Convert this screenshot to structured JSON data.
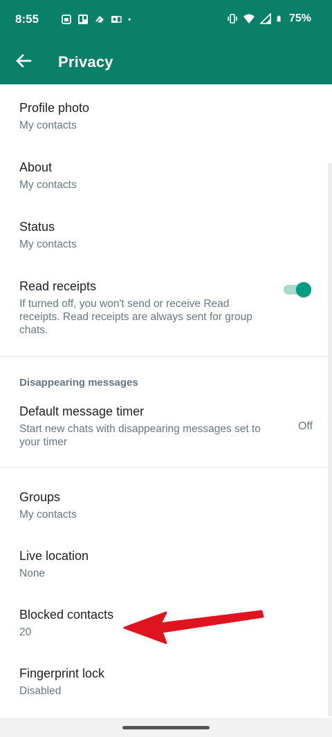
{
  "status_bar": {
    "time": "8:55",
    "battery": "75%",
    "icons": [
      "calendar-icon",
      "trello-icon",
      "cloud-icon",
      "outlook-icon",
      "dot-icon",
      "vibrate-icon",
      "wifi-icon",
      "signal-icon",
      "battery-icon"
    ]
  },
  "app_bar": {
    "title": "Privacy",
    "back_icon": "arrow-left-icon"
  },
  "items": {
    "profile_photo": {
      "title": "Profile photo",
      "subtitle": "My contacts"
    },
    "about": {
      "title": "About",
      "subtitle": "My contacts"
    },
    "status": {
      "title": "Status",
      "subtitle": "My contacts"
    },
    "read_receipts": {
      "title": "Read receipts",
      "subtitle": "If turned off, you won't send or receive Read receipts. Read receipts are always sent for group chats.",
      "enabled": true
    },
    "disappearing_header": "Disappearing messages",
    "default_timer": {
      "title": "Default message timer",
      "subtitle": "Start new chats with disappearing messages set to your timer",
      "value": "Off"
    },
    "groups": {
      "title": "Groups",
      "subtitle": "My contacts"
    },
    "live_location": {
      "title": "Live location",
      "subtitle": "None"
    },
    "blocked_contacts": {
      "title": "Blocked contacts",
      "subtitle": "20"
    },
    "fingerprint_lock": {
      "title": "Fingerprint lock",
      "subtitle": "Disabled"
    }
  },
  "colors": {
    "primary": "#0a8068",
    "accent": "#009d83",
    "annotation_arrow": "#e0141e"
  }
}
